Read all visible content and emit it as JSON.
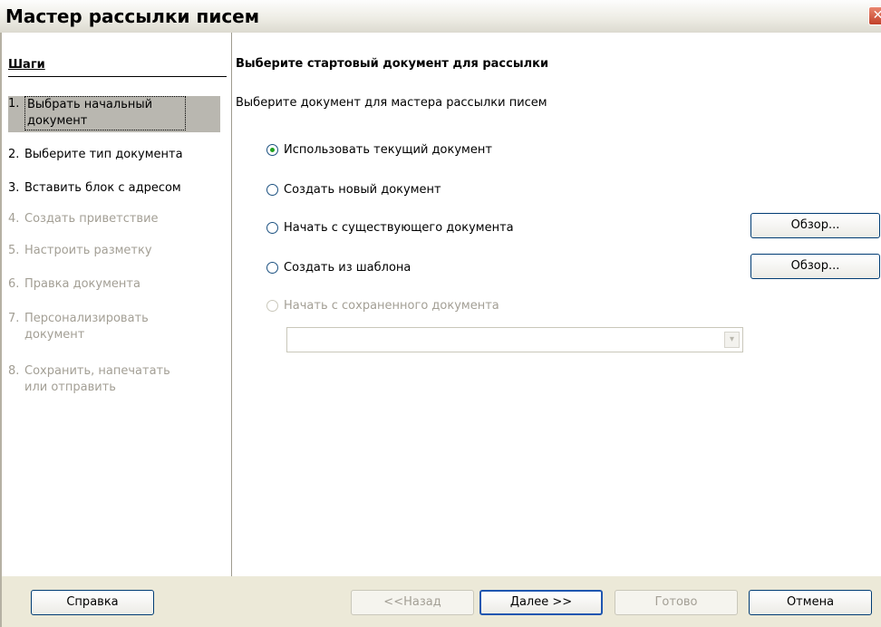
{
  "window": {
    "title": "Мастер рассылки писем",
    "close_glyph": "✕"
  },
  "sidebar": {
    "title": "Шаги",
    "steps": [
      {
        "num": "1.",
        "label": "Выбрать начальный документ"
      },
      {
        "num": "2.",
        "label": "Выберите тип документа"
      },
      {
        "num": "3.",
        "label": "Вставить блок с адресом"
      },
      {
        "num": "4.",
        "label": "Создать приветствие"
      },
      {
        "num": "5.",
        "label": "Настроить разметку"
      },
      {
        "num": "6.",
        "label": "Правка документа"
      },
      {
        "num": "7.",
        "label": "Персонализировать документ"
      },
      {
        "num": "8.",
        "label": "Сохранить, напечатать или отправить"
      }
    ]
  },
  "main": {
    "heading": "Выберите стартовый документ для рассылки",
    "subheading": "Выберите документ для мастера рассылки писем",
    "options": [
      {
        "label": "Использовать текущий документ",
        "checked": true
      },
      {
        "label": "Создать новый документ",
        "checked": false
      },
      {
        "label": "Начать с существующего документа",
        "checked": false
      },
      {
        "label": "Создать из шаблона",
        "checked": false
      },
      {
        "label": "Начать с сохраненного документа",
        "checked": false,
        "disabled": true
      }
    ],
    "browse_existing_label": "Обзор...",
    "browse_template_label": "Обзор...",
    "saved_doc_value": "",
    "dropdown_glyph": "▾"
  },
  "footer": {
    "help_label": "Справка",
    "back_label": "<<Назад",
    "next_label": "Далее >>",
    "finish_label": "Готово",
    "cancel_label": "Отмена"
  }
}
